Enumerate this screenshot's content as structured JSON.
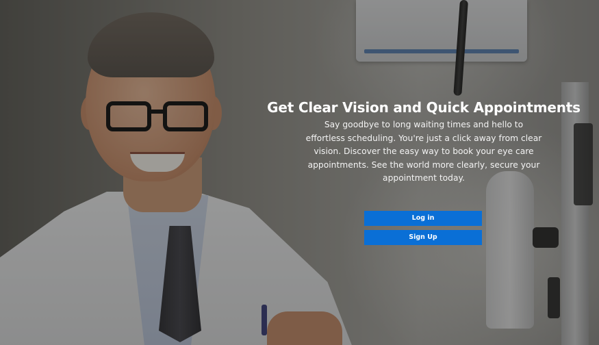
{
  "hero": {
    "headline": "Get Clear Vision and Quick Appointments",
    "tagline": "Say goodbye to long waiting times and hello to effortless scheduling. You're just a click away from clear vision. Discover the easy way to book your eye care appointments. See the world more clearly, secure your appointment today."
  },
  "actions": {
    "login_label": "Log in",
    "signup_label": "Sign Up"
  },
  "colors": {
    "button_bg": "#0a6fd6",
    "text": "#ffffff"
  }
}
